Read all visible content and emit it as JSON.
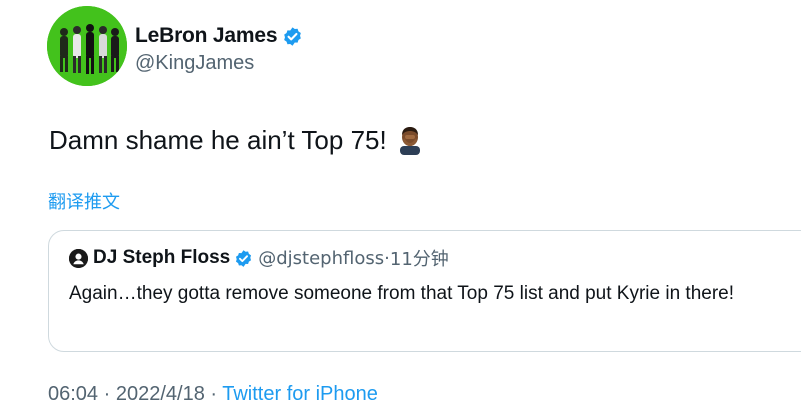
{
  "author": {
    "display_name": "LeBron James",
    "handle": "@KingJames",
    "verified": true
  },
  "tweet": {
    "text": "Damn shame he ain’t Top 75!",
    "emoji": "man-facepalming-dark-skin-tone"
  },
  "translate_label": "翻译推文",
  "quoted_tweet": {
    "display_name": "DJ Steph Floss",
    "handle": "@djstephfloss",
    "separator": "·",
    "time": "11分钟",
    "text": "Again…they gotta remove someone from that Top 75 list and put Kyrie in there!"
  },
  "footer": {
    "time": "06:04",
    "sep1": " · ",
    "date": "2022/4/18",
    "sep2": " · ",
    "source": "Twitter for iPhone"
  },
  "colors": {
    "link": "#1d9bf0",
    "secondary": "#536471",
    "avatar_bg": "#43c21c"
  }
}
